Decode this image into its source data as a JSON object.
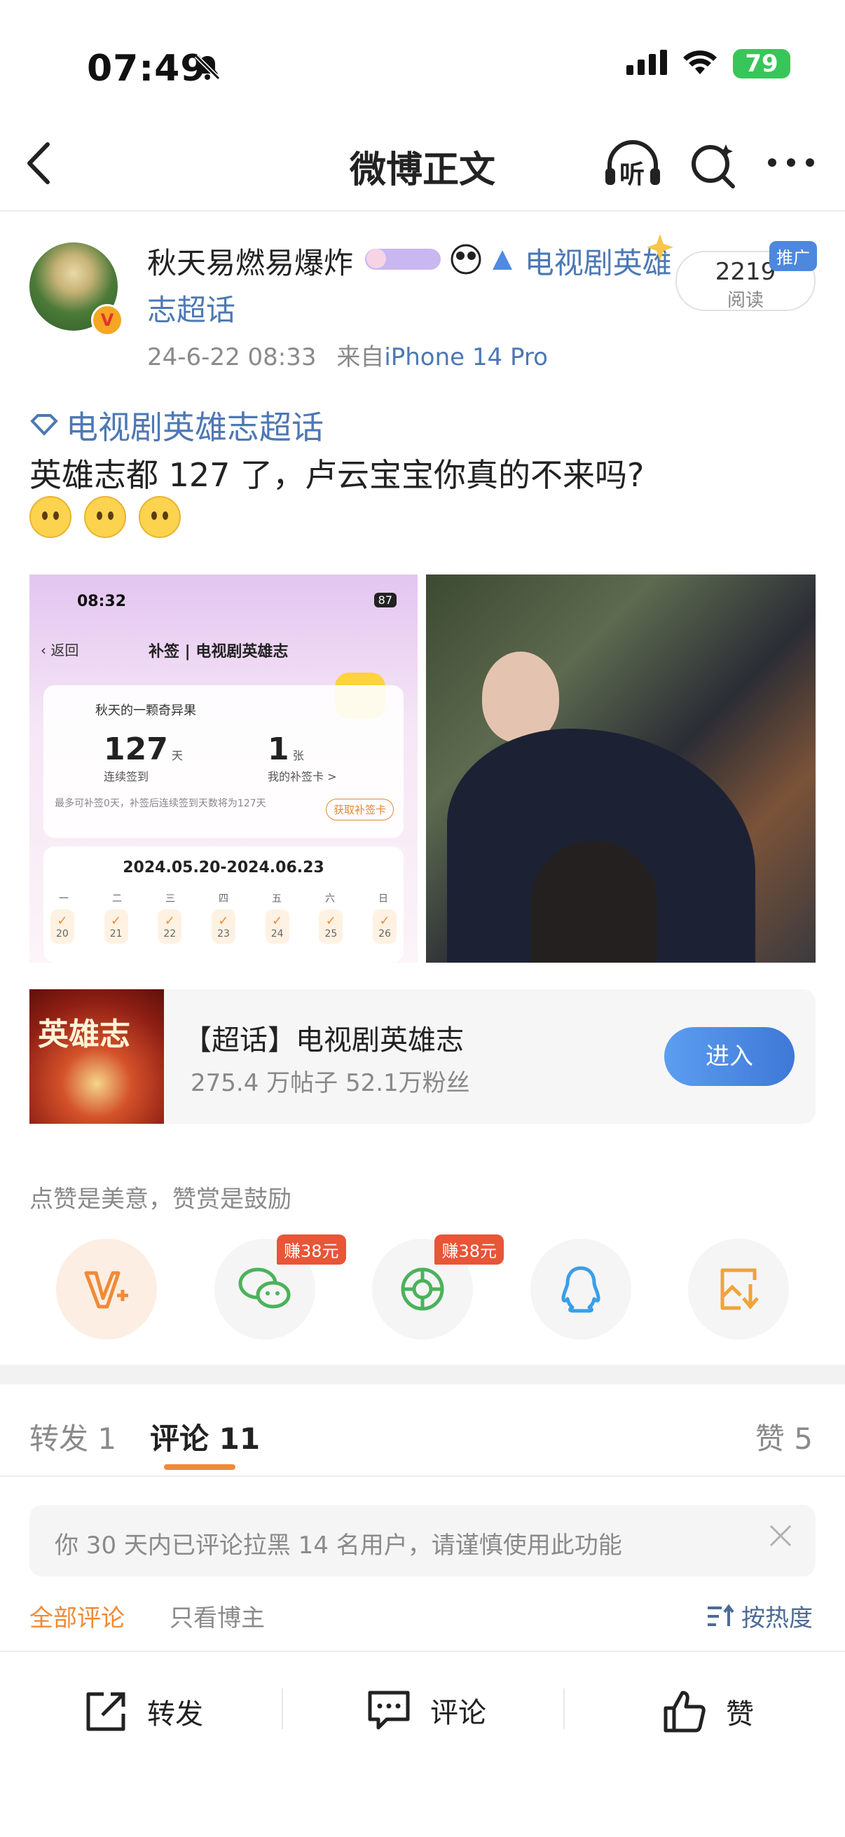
{
  "status_bar": {
    "time": "07:49",
    "battery": "79"
  },
  "nav": {
    "title": "微博正文",
    "listen_label": "听"
  },
  "post": {
    "username": "秋天易燃易爆炸",
    "username_topic": "电视剧英雄志超话",
    "time": "24-6-22 08:33",
    "from_prefix": "来自",
    "device": "iPhone 14 Pro",
    "read_count": "2219",
    "read_label": "阅读",
    "promo_label": "推广",
    "topic": "电视剧英雄志超话",
    "text": "英雄志都 127 了，卢云宝宝你真的不来吗?",
    "screenshot": {
      "time": "08:32",
      "battery": "87",
      "back": "返回",
      "title": "补签 | 电视剧英雄志",
      "user": "秋天的一颗奇异果",
      "streak_value": "127",
      "streak_unit": "天",
      "streak_label": "连续签到",
      "card_value": "1",
      "card_unit": "张",
      "card_label": "我的补签卡 >",
      "note": "最多可补签0天，补签后连续签到天数将为127天",
      "get_card": "获取补签卡",
      "date_range": "2024.05.20-2024.06.23",
      "weekdays": [
        "一",
        "二",
        "三",
        "四",
        "五",
        "六",
        "日"
      ],
      "days": [
        "20",
        "21",
        "22",
        "23",
        "24",
        "25",
        "26"
      ]
    }
  },
  "topic_card": {
    "logo_text": "英雄志",
    "title": "【超话】电视剧英雄志",
    "stats": "275.4 万帖子 52.1万粉丝",
    "enter": "进入"
  },
  "like_note": "点赞是美意，赞赏是鼓励",
  "share": {
    "earn_tag_1": "赚38元",
    "earn_tag_2": "赚38元"
  },
  "tabs": {
    "repost": "转发 1",
    "comments": "评论 11",
    "likes": "赞 5"
  },
  "notice": "你 30 天内已评论拉黑 14 名用户，请谨慎使用此功能",
  "filters": {
    "all": "全部评论",
    "host_only": "只看博主",
    "sort": "按热度"
  },
  "bottom": {
    "repost": "转发",
    "comment": "评论",
    "like": "赞"
  },
  "colors": {
    "accent_orange": "#f08a36",
    "link_blue": "#4d78b4",
    "button_blue": "#4a8be3",
    "earn_red": "#e85537"
  }
}
